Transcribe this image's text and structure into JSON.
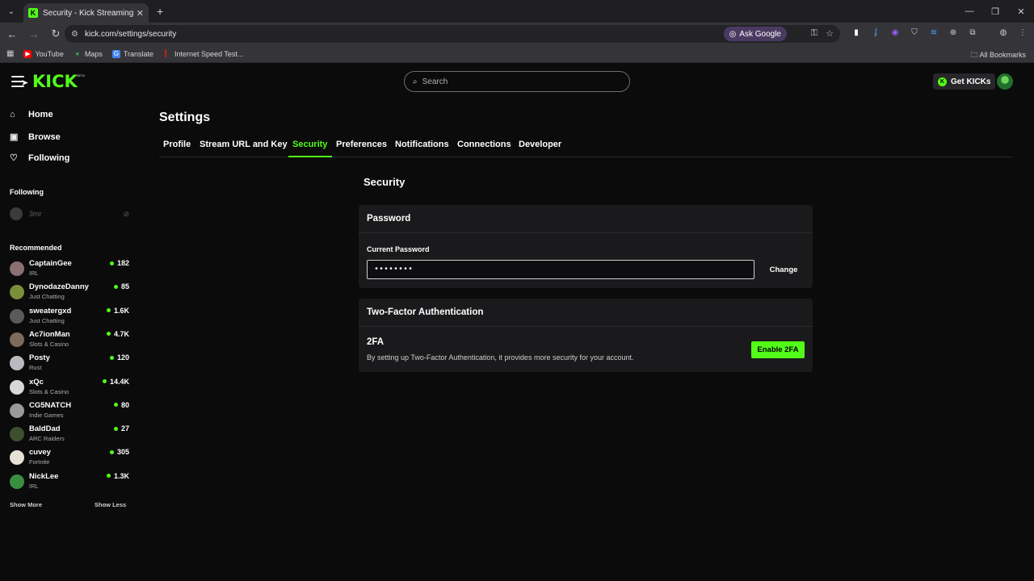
{
  "browser": {
    "tab_title": "Security - Kick Streaming",
    "tab_favicon": "K",
    "url": "kick.com/settings/security",
    "ask_google": "Ask Google",
    "bookmarks": [
      {
        "label": "YouTube",
        "color": "#ff0000"
      },
      {
        "label": "Maps",
        "color": "#34a853"
      },
      {
        "label": "Translate",
        "color": "#4285f4"
      },
      {
        "label": "Internet Speed Test...",
        "color": "#b3261e"
      }
    ],
    "all_bookmarks": "All Bookmarks"
  },
  "header": {
    "logo": "KICK",
    "logo_badge": "BETA",
    "search_placeholder": "Search",
    "get_kicks": "Get KICKs"
  },
  "sidebar": {
    "nav": [
      {
        "label": "Home",
        "icon": "home-icon"
      },
      {
        "label": "Browse",
        "icon": "browse-icon"
      },
      {
        "label": "Following",
        "icon": "heart-icon"
      }
    ],
    "following_title": "Following",
    "following": [
      {
        "name": "3mr",
        "status": "offline"
      }
    ],
    "recommended_title": "Recommended",
    "recommended": [
      {
        "name": "CaptainGee",
        "category": "IRL",
        "viewers": "182",
        "avatar_color": "#8a6f73"
      },
      {
        "name": "DynodazeDanny",
        "category": "Just Chatting",
        "viewers": "85",
        "avatar_color": "#7a8f3a"
      },
      {
        "name": "sweatergxd",
        "category": "Just Chatting",
        "viewers": "1.6K",
        "avatar_color": "#5a5a5a"
      },
      {
        "name": "Ac7ionMan",
        "category": "Slots & Casino",
        "viewers": "4.7K",
        "avatar_color": "#7c6a5a"
      },
      {
        "name": "Posty",
        "category": "Rust",
        "viewers": "120",
        "avatar_color": "#b9b9c0"
      },
      {
        "name": "xQc",
        "category": "Slots & Casino",
        "viewers": "14.4K",
        "avatar_color": "#d8d8d8"
      },
      {
        "name": "CG5NATCH",
        "category": "Indie Games",
        "viewers": "80",
        "avatar_color": "#9a9a9a"
      },
      {
        "name": "BaldDad",
        "category": "ARC Raiders",
        "viewers": "27",
        "avatar_color": "#3e4f2e"
      },
      {
        "name": "cuvey",
        "category": "Fortnite",
        "viewers": "305",
        "avatar_color": "#e6e1d6"
      },
      {
        "name": "NickLee",
        "category": "IRL",
        "viewers": "1.3K",
        "avatar_color": "#3a8f3f"
      }
    ],
    "show_more": "Show More",
    "show_less": "Show Less"
  },
  "settings": {
    "title": "Settings",
    "tabs": [
      "Profile",
      "Stream URL and Key",
      "Security",
      "Preferences",
      "Notifications",
      "Connections",
      "Developer"
    ],
    "active_tab": "Security",
    "section_title": "Security",
    "password": {
      "header": "Password",
      "label": "Current Password",
      "value": "••••••••",
      "change_label": "Change"
    },
    "two_factor": {
      "header": "Two-Factor Authentication",
      "title": "2FA",
      "description": "By setting up Two-Factor Authentication, it provides more security for your account.",
      "enable_label": "Enable 2FA"
    }
  },
  "colors": {
    "accent": "#53fc18",
    "background": "#0b0b0c",
    "card": "#1a1a1c"
  }
}
